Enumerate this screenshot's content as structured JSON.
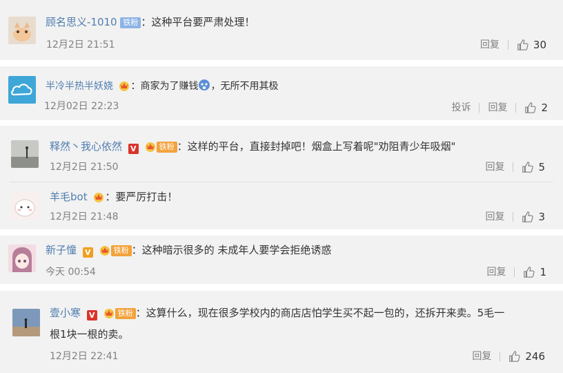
{
  "comments": [
    {
      "user": "顾名思义-1010",
      "fan_badge": "铁粉",
      "text": "：这种平台要严肃处理！",
      "time": "12月2日 21:51",
      "reply": "回复",
      "likes": "30"
    },
    {
      "user": "半冷半热半妖娆",
      "text_before": "：商家为了赚钱",
      "text_after": "，无所不用其极",
      "time": "12月02日 22:23",
      "report": "投诉",
      "reply": "回复",
      "likes": "2"
    },
    {
      "user": "释然丶我心依然",
      "v_badge": "V",
      "fan_badge": "铁粉",
      "text": "：这样的平台，直接封掉吧！烟盒上写着呢\"劝阻青少年吸烟\"",
      "time": "12月2日 21:50",
      "reply": "回复",
      "likes": "5"
    },
    {
      "user": "羊毛bot",
      "text": "：要严厉打击！",
      "time": "12月2日 21:48",
      "reply": "回复",
      "likes": "3"
    },
    {
      "user": "新子憧",
      "v_badge": "V",
      "fan_badge": "铁粉",
      "text": "：这种暗示很多的 未成年人要学会拒绝诱惑",
      "time": "今天 00:54",
      "reply": "回复",
      "likes": "1"
    },
    {
      "user": "壹小寒",
      "v_badge": "V",
      "fan_badge": "铁粉",
      "text": "：这算什么，现在很多学校内的商店店怕学生买不起一包的，还拆开来卖。5毛一",
      "text2": "根1块一根的卖。",
      "time": "12月2日 22:41",
      "reply": "回复",
      "likes": "246"
    }
  ],
  "colors": {
    "username": "#eb7350",
    "card_bg": "#f2f2f2",
    "meta_text": "#808080"
  }
}
